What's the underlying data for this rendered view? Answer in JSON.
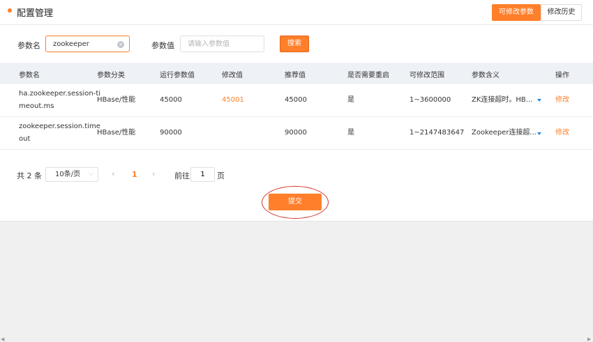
{
  "header": {
    "title": "配置管理",
    "tabs": [
      {
        "label": "可修改参数",
        "active": true
      },
      {
        "label": "修改历史",
        "active": false
      }
    ]
  },
  "filters": {
    "param_name_label": "参数名",
    "param_name_value": "zookeeper",
    "param_value_label": "参数值",
    "param_value_placeholder": "请输入参数值",
    "search_label": "搜索"
  },
  "table": {
    "columns": [
      "参数名",
      "参数分类",
      "运行参数值",
      "修改值",
      "推荐值",
      "是否需要重启",
      "可修改范围",
      "参数含义",
      "操作"
    ],
    "rows": [
      {
        "name_line1": "ha.zookeeper.session-ti",
        "name_line2": "meout.ms",
        "category": "HBase/性能",
        "running_value": "45000",
        "modified_value": "45001",
        "recommended_value": "45000",
        "restart_required": "是",
        "range": "1~3600000",
        "meaning": "ZK连接超时。HB...",
        "action": "修改"
      },
      {
        "name_line1": "zookeeper.session.time",
        "name_line2": "out",
        "category": "HBase/性能",
        "running_value": "90000",
        "modified_value": "",
        "recommended_value": "90000",
        "restart_required": "是",
        "range": "1~2147483647",
        "meaning": "Zookeeper连接超...",
        "action": "修改"
      }
    ]
  },
  "pagination": {
    "total_text": "共 2 条",
    "page_size": "10条/页",
    "prev": "‹",
    "current_page": "1",
    "next": "›",
    "goto_label": "前往",
    "goto_value": "1",
    "page_unit": "页"
  },
  "submit_label": "提交",
  "colors": {
    "accent": "#ff7f2a",
    "annotation": "#d9362b",
    "caret": "#1e88e5"
  }
}
